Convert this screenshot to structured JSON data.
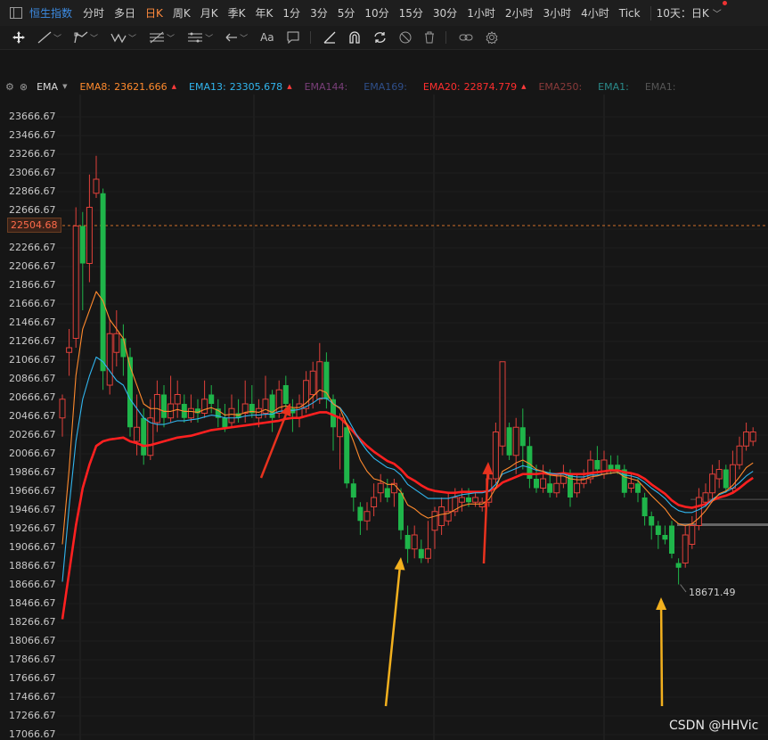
{
  "topbar": {
    "index_name": "恒生指数",
    "timeframes": [
      "分时",
      "多日",
      "日K",
      "周K",
      "月K",
      "季K",
      "年K",
      "1分",
      "3分",
      "5分",
      "10分",
      "15分",
      "30分",
      "1小时",
      "2小时",
      "3小时",
      "4小时",
      "Tick"
    ],
    "active_timeframe": "日K",
    "range_select": "10天：日K"
  },
  "toolbar": {
    "tools": [
      "move-icon",
      "line-icon",
      "path-icon",
      "wave-icon",
      "ruler-icon",
      "channel-icon",
      "undo-icon",
      "text-icon",
      "comment-icon",
      "measure-icon",
      "magnet-icon",
      "sync-icon",
      "hide-icon",
      "delete-icon",
      "link-icon",
      "settings-icon"
    ],
    "text_tool_label": "Aa"
  },
  "ema_bar": {
    "indicator": "EMA",
    "items": [
      {
        "name": "EMA8:",
        "value": "23621.666",
        "color": "#ff8a2d",
        "arrow": true
      },
      {
        "name": "EMA13:",
        "value": "23305.678",
        "color": "#31b5ee",
        "arrow": true
      },
      {
        "name": "EMA144:",
        "value": "",
        "color": "#7a3f7a",
        "arrow": false
      },
      {
        "name": "EMA169:",
        "value": "",
        "color": "#2f4f8a",
        "arrow": false
      },
      {
        "name": "EMA20:",
        "value": "22874.779",
        "color": "#ff2e2e",
        "arrow": true
      },
      {
        "name": "EMA250:",
        "value": "",
        "color": "#8a3a3a",
        "arrow": false
      },
      {
        "name": "EMA1:",
        "value": "",
        "color": "#2a8a8a",
        "arrow": false
      },
      {
        "name": "EMA1:",
        "value": "",
        "color": "#555555",
        "arrow": false
      }
    ]
  },
  "chart_data": {
    "type": "candlestick",
    "y_ticks": [
      "23666.67",
      "23466.67",
      "23266.67",
      "23066.67",
      "22866.67",
      "22666.67",
      "22466.67",
      "22266.67",
      "22066.67",
      "21866.67",
      "21666.67",
      "21466.67",
      "21266.67",
      "21066.67",
      "20866.67",
      "20666.67",
      "20466.67",
      "20266.67",
      "20066.67",
      "19866.67",
      "19666.67",
      "19466.67",
      "19266.67",
      "19066.67",
      "18866.67",
      "18666.67",
      "18466.67",
      "18266.67",
      "18066.67",
      "17866.67",
      "17666.67",
      "17466.67",
      "17266.67",
      "17066.67"
    ],
    "ylim": [
      17066.67,
      23666.67
    ],
    "current_price": "22504.68",
    "current_price_value": 22504.68,
    "low_label": "18671.49",
    "low_label_value": 18671.49,
    "colors": {
      "up": "#e0403a",
      "down": "#1fb54a",
      "ema8": "#ff8a2d",
      "ema13": "#31b5ee",
      "ema20": "#ff2020"
    },
    "candles": [
      {
        "o": 20450,
        "c": 20650,
        "h": 20700,
        "l": 20250
      },
      {
        "o": 21150,
        "c": 21200,
        "h": 21400,
        "l": 20900
      },
      {
        "o": 21300,
        "c": 22500,
        "h": 22700,
        "l": 21200
      },
      {
        "o": 22500,
        "c": 22100,
        "h": 22650,
        "l": 21600
      },
      {
        "o": 22100,
        "c": 22700,
        "h": 23050,
        "l": 21900
      },
      {
        "o": 22850,
        "c": 23000,
        "h": 23250,
        "l": 22800
      },
      {
        "o": 22850,
        "c": 20950,
        "h": 22900,
        "l": 20750
      },
      {
        "o": 20800,
        "c": 21350,
        "h": 21500,
        "l": 20700
      },
      {
        "o": 21150,
        "c": 21350,
        "h": 21600,
        "l": 21000
      },
      {
        "o": 21300,
        "c": 21100,
        "h": 21450,
        "l": 20900
      },
      {
        "o": 21100,
        "c": 20350,
        "h": 21200,
        "l": 20250
      },
      {
        "o": 20200,
        "c": 20350,
        "h": 20700,
        "l": 20050
      },
      {
        "o": 20450,
        "c": 20050,
        "h": 20550,
        "l": 19950
      },
      {
        "o": 20050,
        "c": 20450,
        "h": 20650,
        "l": 20000
      },
      {
        "o": 20400,
        "c": 20700,
        "h": 20850,
        "l": 20300
      },
      {
        "o": 20700,
        "c": 20450,
        "h": 20800,
        "l": 20350
      },
      {
        "o": 20450,
        "c": 20600,
        "h": 20900,
        "l": 20400
      },
      {
        "o": 20600,
        "c": 20700,
        "h": 20850,
        "l": 20450
      },
      {
        "o": 20600,
        "c": 20450,
        "h": 20700,
        "l": 20400
      },
      {
        "o": 20450,
        "c": 20550,
        "h": 20700,
        "l": 20400
      },
      {
        "o": 20550,
        "c": 20500,
        "h": 20650,
        "l": 20400
      },
      {
        "o": 20500,
        "c": 20650,
        "h": 20850,
        "l": 20450
      },
      {
        "o": 20700,
        "c": 20600,
        "h": 20800,
        "l": 20500
      },
      {
        "o": 20550,
        "c": 20450,
        "h": 20650,
        "l": 20350
      },
      {
        "o": 20450,
        "c": 20350,
        "h": 20600,
        "l": 20300
      },
      {
        "o": 20400,
        "c": 20550,
        "h": 20700,
        "l": 20350
      },
      {
        "o": 20500,
        "c": 20450,
        "h": 20650,
        "l": 20400
      },
      {
        "o": 20500,
        "c": 20600,
        "h": 20850,
        "l": 20400
      },
      {
        "o": 20600,
        "c": 20500,
        "h": 20800,
        "l": 20450
      },
      {
        "o": 20450,
        "c": 20550,
        "h": 20650,
        "l": 20350
      },
      {
        "o": 20500,
        "c": 20650,
        "h": 20900,
        "l": 20450
      },
      {
        "o": 20700,
        "c": 20450,
        "h": 20750,
        "l": 20300
      },
      {
        "o": 20500,
        "c": 20750,
        "h": 20850,
        "l": 20450
      },
      {
        "o": 20800,
        "c": 20600,
        "h": 20900,
        "l": 20500
      },
      {
        "o": 20550,
        "c": 20500,
        "h": 20650,
        "l": 20300
      },
      {
        "o": 20450,
        "c": 20600,
        "h": 20700,
        "l": 20350
      },
      {
        "o": 20550,
        "c": 20850,
        "h": 20950,
        "l": 20500
      },
      {
        "o": 20700,
        "c": 20950,
        "h": 21050,
        "l": 20550
      },
      {
        "o": 20650,
        "c": 21050,
        "h": 21250,
        "l": 20600
      },
      {
        "o": 21050,
        "c": 20650,
        "h": 21150,
        "l": 20550
      },
      {
        "o": 20650,
        "c": 20350,
        "h": 20700,
        "l": 20100
      },
      {
        "o": 20250,
        "c": 20450,
        "h": 20500,
        "l": 19900
      },
      {
        "o": 20350,
        "c": 19750,
        "h": 20400,
        "l": 19700
      },
      {
        "o": 19750,
        "c": 19600,
        "h": 19800,
        "l": 19450
      },
      {
        "o": 19500,
        "c": 19350,
        "h": 19550,
        "l": 19200
      },
      {
        "o": 19350,
        "c": 19450,
        "h": 19550,
        "l": 19250
      },
      {
        "o": 19500,
        "c": 19600,
        "h": 19750,
        "l": 19400
      },
      {
        "o": 19650,
        "c": 19750,
        "h": 19850,
        "l": 19550
      },
      {
        "o": 19700,
        "c": 19600,
        "h": 19800,
        "l": 19550
      },
      {
        "o": 19650,
        "c": 19750,
        "h": 19800,
        "l": 19500
      },
      {
        "o": 19650,
        "c": 19250,
        "h": 19700,
        "l": 19150
      },
      {
        "o": 19200,
        "c": 19050,
        "h": 19300,
        "l": 18900
      },
      {
        "o": 19050,
        "c": 19200,
        "h": 19300,
        "l": 18950
      },
      {
        "o": 19050,
        "c": 18950,
        "h": 19150,
        "l": 18900
      },
      {
        "o": 18950,
        "c": 19050,
        "h": 19350,
        "l": 18900
      },
      {
        "o": 19250,
        "c": 19450,
        "h": 19500,
        "l": 19050
      },
      {
        "o": 19300,
        "c": 19500,
        "h": 19600,
        "l": 19200
      },
      {
        "o": 19350,
        "c": 19450,
        "h": 19650,
        "l": 19300
      },
      {
        "o": 19450,
        "c": 19600,
        "h": 19700,
        "l": 19400
      },
      {
        "o": 19550,
        "c": 19600,
        "h": 19700,
        "l": 19450
      },
      {
        "o": 19600,
        "c": 19550,
        "h": 19700,
        "l": 19500
      },
      {
        "o": 19550,
        "c": 19600,
        "h": 19650,
        "l": 19500
      },
      {
        "o": 19500,
        "c": 19550,
        "h": 19600,
        "l": 19450
      },
      {
        "o": 19550,
        "c": 19800,
        "h": 19950,
        "l": 19500
      },
      {
        "o": 19800,
        "c": 20300,
        "h": 20400,
        "l": 19750
      },
      {
        "o": 20150,
        "c": 21050,
        "h": 21050,
        "l": 20050
      },
      {
        "o": 20350,
        "c": 20050,
        "h": 20400,
        "l": 20000
      },
      {
        "o": 20050,
        "c": 20350,
        "h": 20450,
        "l": 19850
      },
      {
        "o": 20350,
        "c": 20150,
        "h": 20550,
        "l": 19900
      },
      {
        "o": 20150,
        "c": 19800,
        "h": 20250,
        "l": 19700
      },
      {
        "o": 19800,
        "c": 19700,
        "h": 19950,
        "l": 19650
      },
      {
        "o": 19700,
        "c": 19800,
        "h": 19950,
        "l": 19650
      },
      {
        "o": 19750,
        "c": 19650,
        "h": 19900,
        "l": 19600
      },
      {
        "o": 19650,
        "c": 19750,
        "h": 19850,
        "l": 19600
      },
      {
        "o": 19750,
        "c": 19850,
        "h": 19950,
        "l": 19700
      },
      {
        "o": 19850,
        "c": 19600,
        "h": 19900,
        "l": 19500
      },
      {
        "o": 19650,
        "c": 19750,
        "h": 19850,
        "l": 19600
      },
      {
        "o": 19750,
        "c": 19800,
        "h": 19900,
        "l": 19700
      },
      {
        "o": 19800,
        "c": 20000,
        "h": 20100,
        "l": 19750
      },
      {
        "o": 20000,
        "c": 19900,
        "h": 20150,
        "l": 19850
      },
      {
        "o": 19850,
        "c": 20000,
        "h": 20100,
        "l": 19800
      },
      {
        "o": 19950,
        "c": 19900,
        "h": 20050,
        "l": 19850
      },
      {
        "o": 19950,
        "c": 19900,
        "h": 20050,
        "l": 19850
      },
      {
        "o": 19900,
        "c": 19650,
        "h": 19950,
        "l": 19600
      },
      {
        "o": 19700,
        "c": 19750,
        "h": 19850,
        "l": 19650
      },
      {
        "o": 19750,
        "c": 19650,
        "h": 19800,
        "l": 19550
      },
      {
        "o": 19600,
        "c": 19400,
        "h": 19650,
        "l": 19300
      },
      {
        "o": 19400,
        "c": 19300,
        "h": 19450,
        "l": 19150
      },
      {
        "o": 19300,
        "c": 19200,
        "h": 19350,
        "l": 19050
      },
      {
        "o": 19200,
        "c": 19150,
        "h": 19300,
        "l": 19100
      },
      {
        "o": 19300,
        "c": 19000,
        "h": 19350,
        "l": 18950
      },
      {
        "o": 18900,
        "c": 18850,
        "h": 18950,
        "l": 18671.49
      },
      {
        "o": 18900,
        "c": 19200,
        "h": 19300,
        "l": 18850
      },
      {
        "o": 19100,
        "c": 19300,
        "h": 19400,
        "l": 19050
      },
      {
        "o": 19300,
        "c": 19600,
        "h": 19700,
        "l": 19250
      },
      {
        "o": 19550,
        "c": 19650,
        "h": 19750,
        "l": 19500
      },
      {
        "o": 19650,
        "c": 19850,
        "h": 19950,
        "l": 19550
      },
      {
        "o": 19800,
        "c": 19900,
        "h": 20000,
        "l": 19700
      },
      {
        "o": 19900,
        "c": 19700,
        "h": 19950,
        "l": 19650
      },
      {
        "o": 19700,
        "c": 19950,
        "h": 20100,
        "l": 19650
      },
      {
        "o": 19950,
        "c": 20150,
        "h": 20250,
        "l": 19900
      },
      {
        "o": 20150,
        "c": 20300,
        "h": 20400,
        "l": 20100
      },
      {
        "o": 20200,
        "c": 20300,
        "h": 20350,
        "l": 20150
      }
    ],
    "ema8": [
      19100,
      19900,
      20900,
      21400,
      21600,
      21800,
      21700,
      21500,
      21400,
      21300,
      21000,
      20800,
      20600,
      20550,
      20550,
      20520,
      20520,
      20540,
      20520,
      20520,
      20510,
      20540,
      20560,
      20530,
      20480,
      20490,
      20480,
      20510,
      20520,
      20510,
      20540,
      20510,
      20560,
      20580,
      20560,
      20560,
      20610,
      20680,
      20750,
      20720,
      20600,
      20550,
      20380,
      20200,
      20000,
      19880,
      19800,
      19780,
      19740,
      19740,
      19660,
      19520,
      19480,
      19420,
      19380,
      19400,
      19420,
      19430,
      19470,
      19510,
      19530,
      19530,
      19530,
      19580,
      19700,
      19880,
      19920,
      19970,
      20000,
      19960,
      19900,
      19880,
      19840,
      19830,
      19830,
      19800,
      19790,
      19790,
      19820,
      19830,
      19850,
      19860,
      19870,
      19820,
      19800,
      19780,
      19700,
      19620,
      19550,
      19480,
      19380,
      19320,
      19300,
      19320,
      19380,
      19460,
      19560,
      19640,
      19670,
      19730,
      19820,
      19920,
      19970
    ],
    "ema13": [
      18700,
      19500,
      20200,
      20650,
      20900,
      21100,
      21050,
      20950,
      20850,
      20800,
      20650,
      20550,
      20450,
      20400,
      20380,
      20380,
      20400,
      20420,
      20420,
      20430,
      20440,
      20460,
      20480,
      20470,
      20450,
      20450,
      20450,
      20470,
      20480,
      20480,
      20490,
      20490,
      20520,
      20530,
      20530,
      20540,
      20570,
      20610,
      20660,
      20660,
      20600,
      20560,
      20460,
      20330,
      20200,
      20100,
      20020,
      19970,
      19920,
      19900,
      19840,
      19740,
      19690,
      19640,
      19590,
      19590,
      19590,
      19590,
      19610,
      19630,
      19640,
      19650,
      19650,
      19670,
      19740,
      19850,
      19880,
      19910,
      19940,
      19920,
      19890,
      19880,
      19860,
      19850,
      19850,
      19830,
      19820,
      19820,
      19840,
      19840,
      19850,
      19860,
      19870,
      19840,
      19830,
      19810,
      19760,
      19700,
      19650,
      19590,
      19510,
      19460,
      19440,
      19440,
      19470,
      19510,
      19580,
      19630,
      19660,
      19700,
      19760,
      19830,
      19880
    ],
    "ema20": [
      18300,
      18800,
      19300,
      19700,
      19950,
      20150,
      20200,
      20220,
      20230,
      20240,
      20200,
      20180,
      20150,
      20160,
      20180,
      20200,
      20220,
      20240,
      20250,
      20260,
      20280,
      20300,
      20320,
      20330,
      20340,
      20350,
      20360,
      20370,
      20380,
      20390,
      20400,
      20410,
      20420,
      20440,
      20450,
      20450,
      20470,
      20490,
      20510,
      20510,
      20480,
      20450,
      20380,
      20300,
      20220,
      20150,
      20090,
      20040,
      19990,
      19960,
      19900,
      19820,
      19780,
      19730,
      19690,
      19670,
      19660,
      19650,
      19650,
      19660,
      19660,
      19660,
      19660,
      19670,
      19700,
      19760,
      19790,
      19820,
      19850,
      19850,
      19850,
      19860,
      19850,
      19850,
      19860,
      19850,
      19850,
      19850,
      19860,
      19870,
      19880,
      19890,
      19890,
      19870,
      19860,
      19840,
      19800,
      19740,
      19690,
      19640,
      19570,
      19520,
      19500,
      19490,
      19510,
      19530,
      19570,
      19600,
      19620,
      19650,
      19700,
      19760,
      19810
    ]
  }
}
